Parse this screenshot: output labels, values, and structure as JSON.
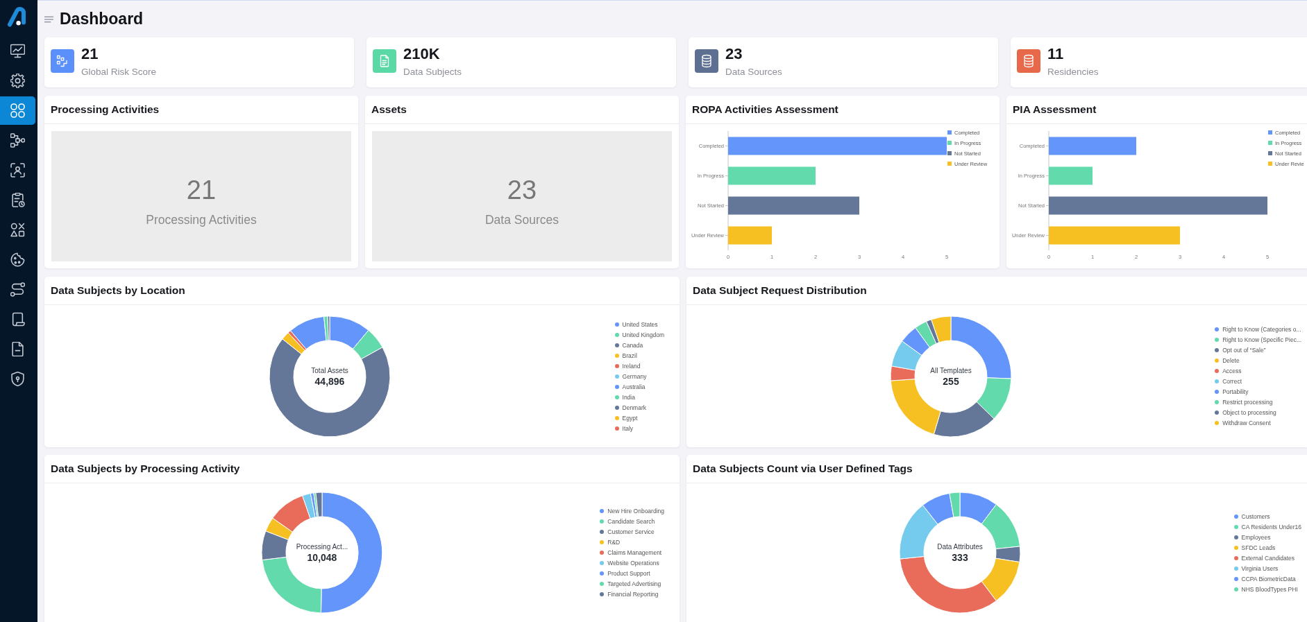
{
  "sidebar": {
    "items": [
      {
        "kind": "monitor",
        "selected": false
      },
      {
        "kind": "gear",
        "selected": false
      },
      {
        "kind": "grid",
        "selected": true
      },
      {
        "kind": "flow",
        "selected": false
      },
      {
        "kind": "scan",
        "selected": false
      },
      {
        "kind": "clipboard",
        "selected": false
      },
      {
        "kind": "shapes",
        "selected": false
      },
      {
        "kind": "cookie",
        "selected": false
      },
      {
        "kind": "route",
        "selected": false
      },
      {
        "kind": "scroll",
        "selected": false
      },
      {
        "kind": "file",
        "selected": false
      },
      {
        "kind": "shield",
        "selected": false
      }
    ]
  },
  "header": {
    "title": "Dashboard"
  },
  "stats": [
    {
      "kind": "steps",
      "color": "#5b8ff9",
      "value": "21",
      "label": "Global Risk Score"
    },
    {
      "kind": "document",
      "color": "#5ad8a6",
      "value": "210K",
      "label": "Data Subjects"
    },
    {
      "kind": "database",
      "color": "#5d7092",
      "value": "23",
      "label": "Data Sources"
    },
    {
      "kind": "database",
      "color": "#e8684a",
      "value": "11",
      "label": "Residencies"
    }
  ],
  "summary_cards": [
    {
      "title": "Processing Activities",
      "value": "21",
      "label": "Processing Activities"
    },
    {
      "title": "Assets",
      "value": "23",
      "label": "Data Sources"
    }
  ],
  "bar_charts": [
    {
      "title": "ROPA Activities Assessment",
      "chart_data": {
        "type": "bar",
        "orientation": "horizontal",
        "legend": "top-right",
        "categories": [
          "Completed",
          "In Progress",
          "Not Started",
          "Under Review"
        ],
        "series": [
          {
            "name": "Completed",
            "color": "#6395fa",
            "values": [
              5,
              null,
              null,
              null
            ]
          },
          {
            "name": "In Progress",
            "color": "#62daab",
            "values": [
              null,
              2,
              null,
              null
            ]
          },
          {
            "name": "Not Started",
            "color": "#657798",
            "values": [
              null,
              null,
              3,
              null
            ]
          },
          {
            "name": "Under Review",
            "color": "#f6c022",
            "values": [
              null,
              null,
              null,
              1
            ]
          }
        ],
        "xlim": [
          0,
          5
        ],
        "xticks": [
          0,
          1,
          2,
          3,
          4,
          5
        ]
      }
    },
    {
      "title": "PIA Assessment",
      "chart_data": {
        "type": "bar",
        "orientation": "horizontal",
        "legend": "top-right",
        "categories": [
          "Completed",
          "In Progress",
          "Not Started",
          "Under Review"
        ],
        "series": [
          {
            "name": "Completed",
            "color": "#6395fa",
            "values": [
              2,
              null,
              null,
              null
            ]
          },
          {
            "name": "In Progress",
            "color": "#62daab",
            "values": [
              null,
              1,
              null,
              null
            ]
          },
          {
            "name": "Not Started",
            "color": "#657798",
            "values": [
              null,
              null,
              5,
              null
            ]
          },
          {
            "name": "Under Revie",
            "color": "#f6c022",
            "values": [
              null,
              null,
              null,
              3
            ]
          }
        ],
        "xlim": [
          0,
          5
        ],
        "xticks": [
          0,
          1,
          2,
          3,
          4,
          5
        ]
      }
    }
  ],
  "donut_cards": [
    {
      "title": "Data Subjects by Location",
      "center_label": "Total Assets",
      "center_value": "44,896",
      "legend": [
        {
          "label": "United States",
          "color": "#6395fa"
        },
        {
          "label": "United Kingdom",
          "color": "#62daab"
        },
        {
          "label": "Canada",
          "color": "#657798"
        },
        {
          "label": "Brazil",
          "color": "#f6c022"
        },
        {
          "label": "Ireland",
          "color": "#e96c5b"
        },
        {
          "label": "Germany",
          "color": "#74cbed"
        },
        {
          "label": "Australia",
          "color": "#6395fa"
        },
        {
          "label": "India",
          "color": "#62daab"
        },
        {
          "label": "Denmark",
          "color": "#657798"
        },
        {
          "label": "Egypt",
          "color": "#f6c022"
        },
        {
          "label": "Italy",
          "color": "#e96c5b"
        }
      ]
    },
    {
      "title": "Data Subject Request Distribution",
      "center_label": "All Templates",
      "center_value": "255",
      "legend": [
        {
          "label": "Right to Know (Categories o...",
          "color": "#6395fa"
        },
        {
          "label": "Right to Know (Specific Piec...",
          "color": "#62daab"
        },
        {
          "label": "Opt out of “Sale”",
          "color": "#657798"
        },
        {
          "label": "Delete",
          "color": "#f6c022"
        },
        {
          "label": "Access",
          "color": "#e96c5b"
        },
        {
          "label": "Correct",
          "color": "#74cbed"
        },
        {
          "label": "Portability",
          "color": "#6395fa"
        },
        {
          "label": "Restrict processing",
          "color": "#62daab"
        },
        {
          "label": "Object to processing",
          "color": "#657798"
        },
        {
          "label": "Withdraw Consent",
          "color": "#f6c022"
        }
      ]
    },
    {
      "title": "Data Subjects by Processing Activity",
      "center_label": "Processing Act...",
      "center_value": "10,048",
      "legend": [
        {
          "label": "New Hire Onboarding",
          "color": "#6395fa"
        },
        {
          "label": "Candidate Search",
          "color": "#62daab"
        },
        {
          "label": "Customer Service",
          "color": "#657798"
        },
        {
          "label": "R&D",
          "color": "#f6c022"
        },
        {
          "label": "Claims Management",
          "color": "#e96c5b"
        },
        {
          "label": "Website Operations",
          "color": "#74cbed"
        },
        {
          "label": "Product Support",
          "color": "#6395fa"
        },
        {
          "label": "Targeted Advertising",
          "color": "#62daab"
        },
        {
          "label": "Financial Reporting",
          "color": "#657798"
        }
      ]
    },
    {
      "title": "Data Subjects Count via User Defined Tags",
      "center_label": "Data Attributes",
      "center_value": "333",
      "legend": [
        {
          "label": "Customers",
          "color": "#6395fa"
        },
        {
          "label": "CA Residents Under16",
          "color": "#62daab"
        },
        {
          "label": "Employees",
          "color": "#657798"
        },
        {
          "label": "SFDC Leads",
          "color": "#f6c022"
        },
        {
          "label": "External Candidates",
          "color": "#e96c5b"
        },
        {
          "label": "Virginia Users",
          "color": "#74cbed"
        },
        {
          "label": "CCPA BiometricData",
          "color": "#6395fa"
        },
        {
          "label": "NHS BloodTypes PHI",
          "color": "#62daab"
        }
      ]
    }
  ]
}
